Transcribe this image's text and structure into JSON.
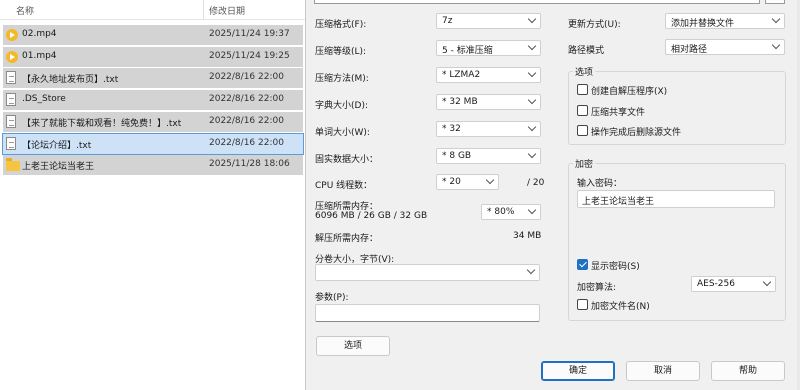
{
  "explorer": {
    "columns": {
      "name": "名称",
      "date": "修改日期"
    },
    "files": [
      {
        "name": "02.mp4",
        "date": "2025/11/24 19:37",
        "icon": "video-file-icon"
      },
      {
        "name": "01.mp4",
        "date": "2025/11/24 19:25",
        "icon": "video-file-icon"
      },
      {
        "name": "【永久地址发布页】.txt",
        "date": "2022/8/16 22:00",
        "icon": "text-file-icon"
      },
      {
        "name": ".DS_Store",
        "date": "2022/8/16 22:00",
        "icon": "generic-file-icon"
      },
      {
        "name": "【来了就能下载和观看！纯免费！】.txt",
        "date": "2022/8/16 22:00",
        "icon": "text-file-icon"
      },
      {
        "name": "【论坛介绍】.txt",
        "date": "2022/8/16 22:00",
        "icon": "text-file-icon"
      },
      {
        "name": "上老王论坛当老王",
        "date": "2025/11/28 18:06",
        "icon": "folder-icon"
      }
    ]
  },
  "dialog": {
    "format": {
      "label": "压缩格式(F):",
      "value": "7z"
    },
    "level": {
      "label": "压缩等级(L):",
      "value": "5 - 标准压缩"
    },
    "method": {
      "label": "压缩方法(M):",
      "value": "* LZMA2"
    },
    "dict": {
      "label": "字典大小(D):",
      "value": "* 32 MB"
    },
    "word": {
      "label": "单词大小(W):",
      "value": "* 32"
    },
    "solid": {
      "label": "固实数据大小：",
      "value": "* 8 GB"
    },
    "threads": {
      "label": "CPU 线程数：",
      "value": "* 20",
      "max": "/ 20"
    },
    "mem_compress": {
      "label": "压缩所需内存：",
      "detail": "6096 MB / 26 GB / 32 GB",
      "value": "* 80%"
    },
    "mem_decompress": {
      "label": "解压所需内存：",
      "value": "34 MB"
    },
    "split": {
      "label": "分卷大小，字节(V):",
      "value": ""
    },
    "params": {
      "label": "参数(P):",
      "value": ""
    },
    "options_button": "选项",
    "update": {
      "label": "更新方式(U):",
      "value": "添加并替换文件"
    },
    "path": {
      "label": "路径模式",
      "value": "相对路径"
    },
    "options_group": {
      "title": "选项",
      "items": [
        {
          "label": "创建自解压程序(X)",
          "checked": false
        },
        {
          "label": "压缩共享文件",
          "checked": false
        },
        {
          "label": "操作完成后删除源文件",
          "checked": false
        }
      ]
    },
    "encryption": {
      "title": "加密",
      "password_label": "输入密码：",
      "password_value": "上老王论坛当老王",
      "show_password": {
        "label": "显示密码(S)",
        "checked": true
      },
      "method_label": "加密算法:",
      "method_value": "AES-256",
      "encrypt_names": {
        "label": "加密文件名(N)",
        "checked": false
      }
    },
    "buttons": {
      "ok": "确定",
      "cancel": "取消",
      "help": "帮助"
    }
  },
  "colors": {
    "accent": "#1f6fc5",
    "selection": "#d3d3d3",
    "focus": "#cde2f6"
  }
}
